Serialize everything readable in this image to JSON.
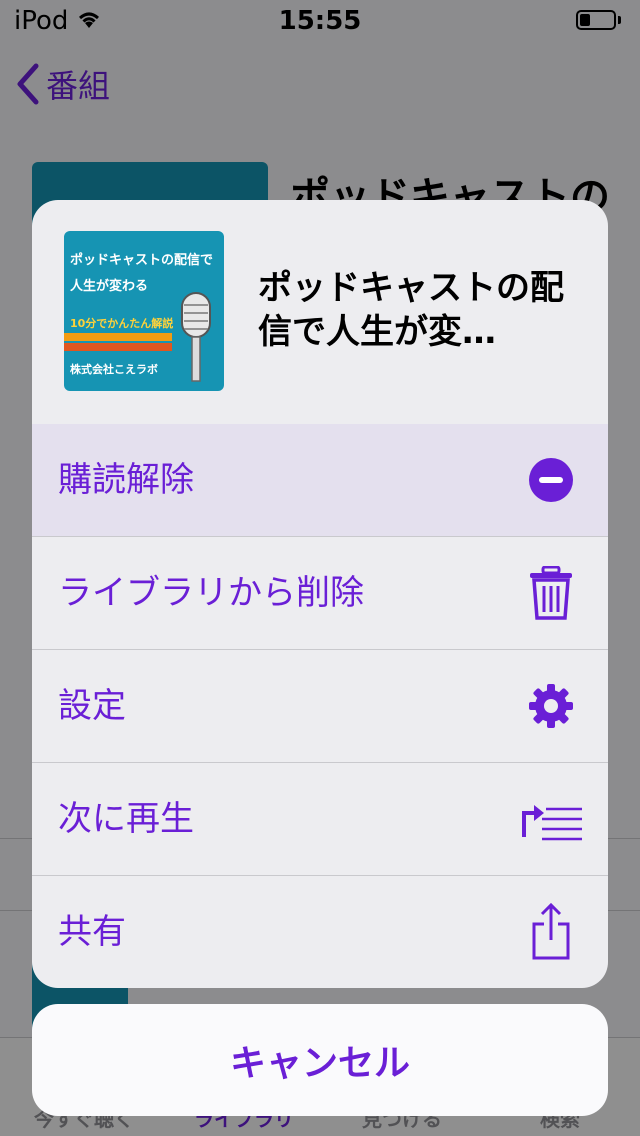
{
  "status_bar": {
    "carrier": "iPod",
    "time": "15:55",
    "battery_level": 0.3
  },
  "nav": {
    "back_label": "番組"
  },
  "background": {
    "podcast_title": "ポッドキャストの",
    "tabs": [
      "今すぐ聴く",
      "ライブラリ",
      "見つける",
      "検索"
    ],
    "active_tab": "ライブラリ"
  },
  "sheet": {
    "title": "ポッドキャストの配信で人生が変…",
    "artwork": {
      "line1": "ポッドキャストの配信で",
      "line2": "人生が変わる",
      "line3": "10分でかんたん解説",
      "line4": "株式会社こえラボ"
    },
    "actions": [
      {
        "label": "購読解除",
        "icon": "minus-circle-icon"
      },
      {
        "label": "ライブラリから削除",
        "icon": "trash-icon"
      },
      {
        "label": "設定",
        "icon": "gear-icon"
      },
      {
        "label": "次に再生",
        "icon": "play-next-icon"
      },
      {
        "label": "共有",
        "icon": "share-icon"
      }
    ],
    "cancel_label": "キャンセル"
  },
  "colors": {
    "accent": "#6a1fd6",
    "sheet_bg": "#ededf0"
  }
}
